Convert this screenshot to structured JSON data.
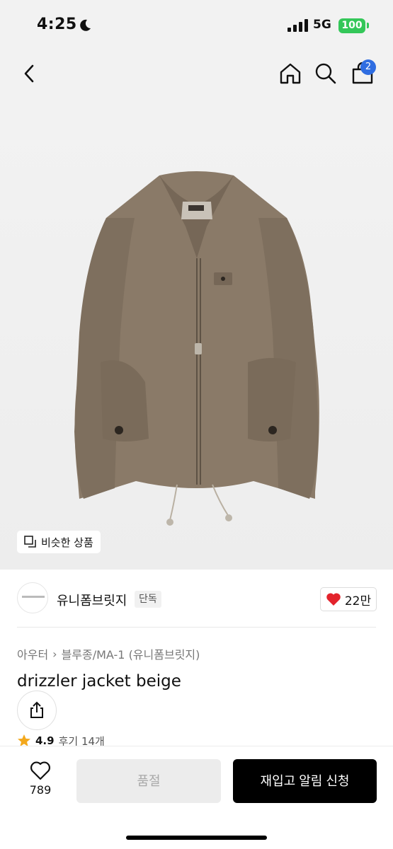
{
  "status_bar": {
    "time": "4:25",
    "network": "5G",
    "battery": "100"
  },
  "nav": {
    "cart_badge": "2"
  },
  "hero": {
    "similar_label": "비슷한 상품"
  },
  "brand": {
    "name": "유니폼브릿지",
    "tag": "단독",
    "likes": "22만"
  },
  "breadcrumb": {
    "category": "아우터",
    "sub": "블루종/MA-1 (유니폼브릿지)"
  },
  "product": {
    "title": "drizzler jacket beige",
    "rating": "4.9",
    "reviews": "후기 14개"
  },
  "bottom": {
    "wish_count": "789",
    "soldout_label": "품절",
    "restock_label": "재입고 알림 신청"
  },
  "colors": {
    "accent_blue": "#2f6de1",
    "heart_red": "#e3232c",
    "battery_green": "#34c759",
    "jacket_brown": "#8a7a68"
  }
}
